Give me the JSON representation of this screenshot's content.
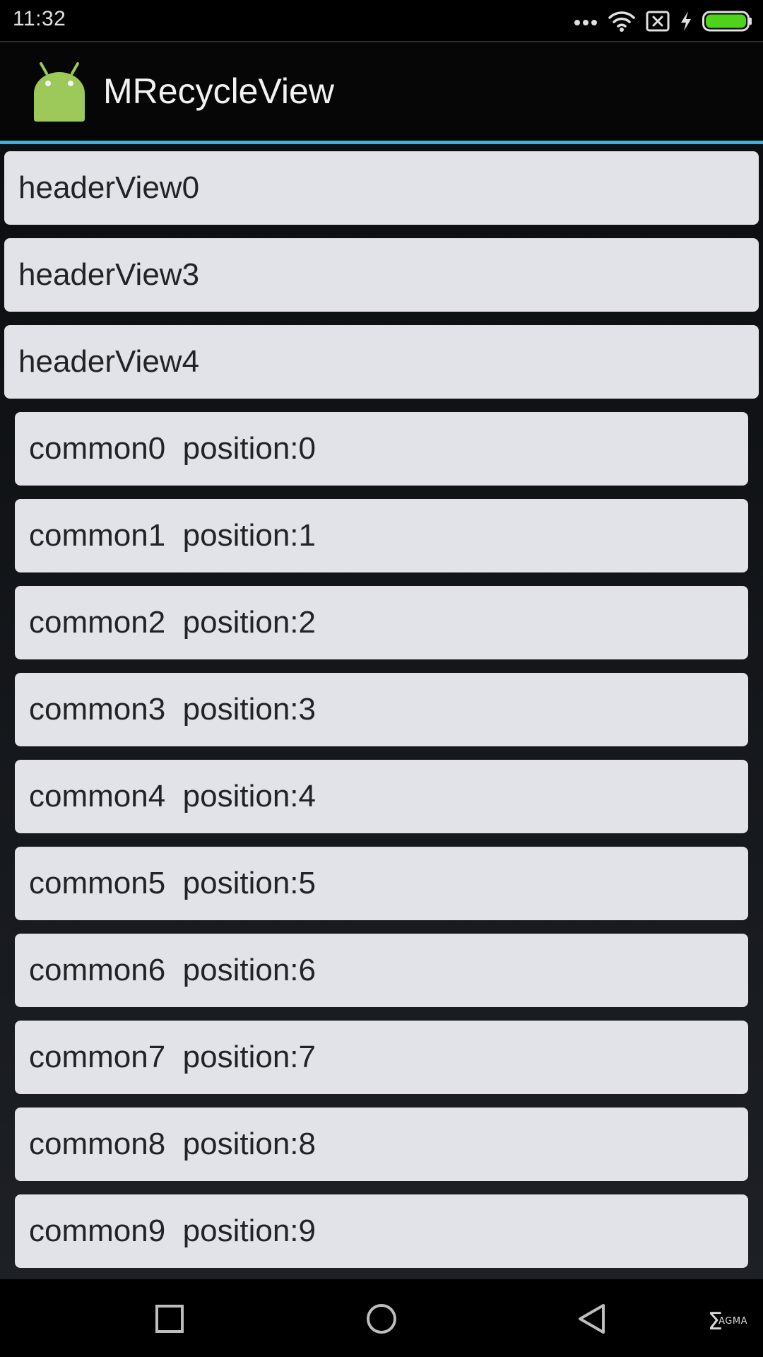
{
  "status_bar": {
    "time": "11:32",
    "icons": [
      "more-dots-icon",
      "wifi-icon",
      "no-sim-icon",
      "charging-icon",
      "battery-icon"
    ],
    "battery_color": "#4cd31a"
  },
  "action_bar": {
    "app_icon": "android-robot-icon",
    "title": "MRecycleView",
    "accent_color": "#33b5e5"
  },
  "list": {
    "header_items": [
      {
        "label": "headerView0"
      },
      {
        "label": "headerView3"
      },
      {
        "label": "headerView4"
      }
    ],
    "common_items": [
      {
        "label": "common0  position:0"
      },
      {
        "label": "common1  position:1"
      },
      {
        "label": "common2  position:2"
      },
      {
        "label": "common3  position:3"
      },
      {
        "label": "common4  position:4"
      },
      {
        "label": "common5  position:5"
      },
      {
        "label": "common6  position:6"
      },
      {
        "label": "common7  position:7"
      },
      {
        "label": "common8  position:8"
      },
      {
        "label": "common9  position:9"
      }
    ]
  },
  "nav_bar": {
    "buttons": [
      "recents-square-icon",
      "home-circle-icon",
      "back-triangle-icon"
    ],
    "watermark": {
      "glyph": "Σ",
      "text": "AGMA"
    }
  }
}
